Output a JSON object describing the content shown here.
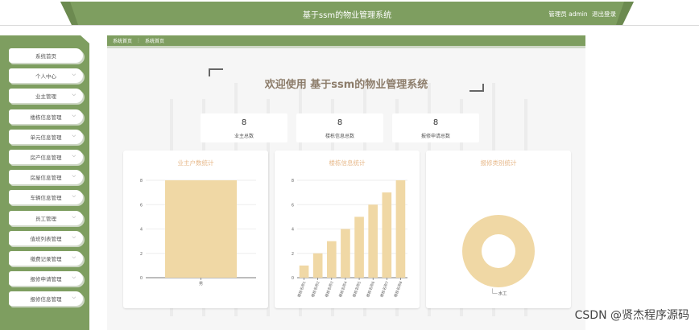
{
  "header": {
    "system_title": "基于ssm的物业管理系统",
    "user_label": "管理员 admin",
    "logout_label": "退出登录",
    "accent_color": "#7e9e60"
  },
  "sidebar": {
    "items": [
      {
        "label": "系统首页",
        "has_chevron": false
      },
      {
        "label": "个人中心",
        "has_chevron": true
      },
      {
        "label": "业主管理",
        "has_chevron": true
      },
      {
        "label": "楼栋信息管理",
        "has_chevron": true
      },
      {
        "label": "单元信息管理",
        "has_chevron": true
      },
      {
        "label": "房产信息管理",
        "has_chevron": true
      },
      {
        "label": "房屋信息管理",
        "has_chevron": true
      },
      {
        "label": "车辆信息管理",
        "has_chevron": true
      },
      {
        "label": "员工管理",
        "has_chevron": true
      },
      {
        "label": "值班列表管理",
        "has_chevron": true
      },
      {
        "label": "缴费记录管理",
        "has_chevron": true
      },
      {
        "label": "报修申请管理",
        "has_chevron": true
      },
      {
        "label": "报修信息管理",
        "has_chevron": true
      }
    ]
  },
  "breadcrumb": {
    "root": "系统首页",
    "separator": "⋮",
    "current": "系统首页"
  },
  "welcome": {
    "text": "欢迎使用 基于ssm的物业管理系统"
  },
  "stats": [
    {
      "value": "8",
      "label": "业主总数"
    },
    {
      "value": "8",
      "label": "楼栋信息总数"
    },
    {
      "value": "8",
      "label": "报修申请总数"
    }
  ],
  "chart_data": [
    {
      "type": "bar",
      "title": "业主户数统计",
      "categories": [
        "男"
      ],
      "values": [
        8
      ],
      "ylim": [
        0,
        8
      ],
      "yticks": [
        "0",
        "2",
        "4",
        "6",
        "8"
      ],
      "color": "#f0d8a5"
    },
    {
      "type": "bar",
      "title": "楼栋信息统计",
      "categories": [
        "楼栋名称1",
        "楼栋名称2",
        "楼栋名称3",
        "楼栋名称4",
        "楼栋名称5",
        "楼栋名称6",
        "楼栋名称7",
        "楼栋名称8"
      ],
      "values": [
        1,
        2,
        3,
        4,
        5,
        6,
        7,
        8
      ],
      "ylim": [
        0,
        8
      ],
      "yticks": [
        "0",
        "2",
        "4",
        "6",
        "8"
      ],
      "color": "#f0d8a5"
    },
    {
      "type": "pie",
      "title": "报修类别统计",
      "slices": [
        {
          "label": "水工",
          "value": 1
        }
      ],
      "donut": true,
      "color": "#f0d8a5"
    }
  ],
  "watermark": "CSDN @贤杰程序源码"
}
